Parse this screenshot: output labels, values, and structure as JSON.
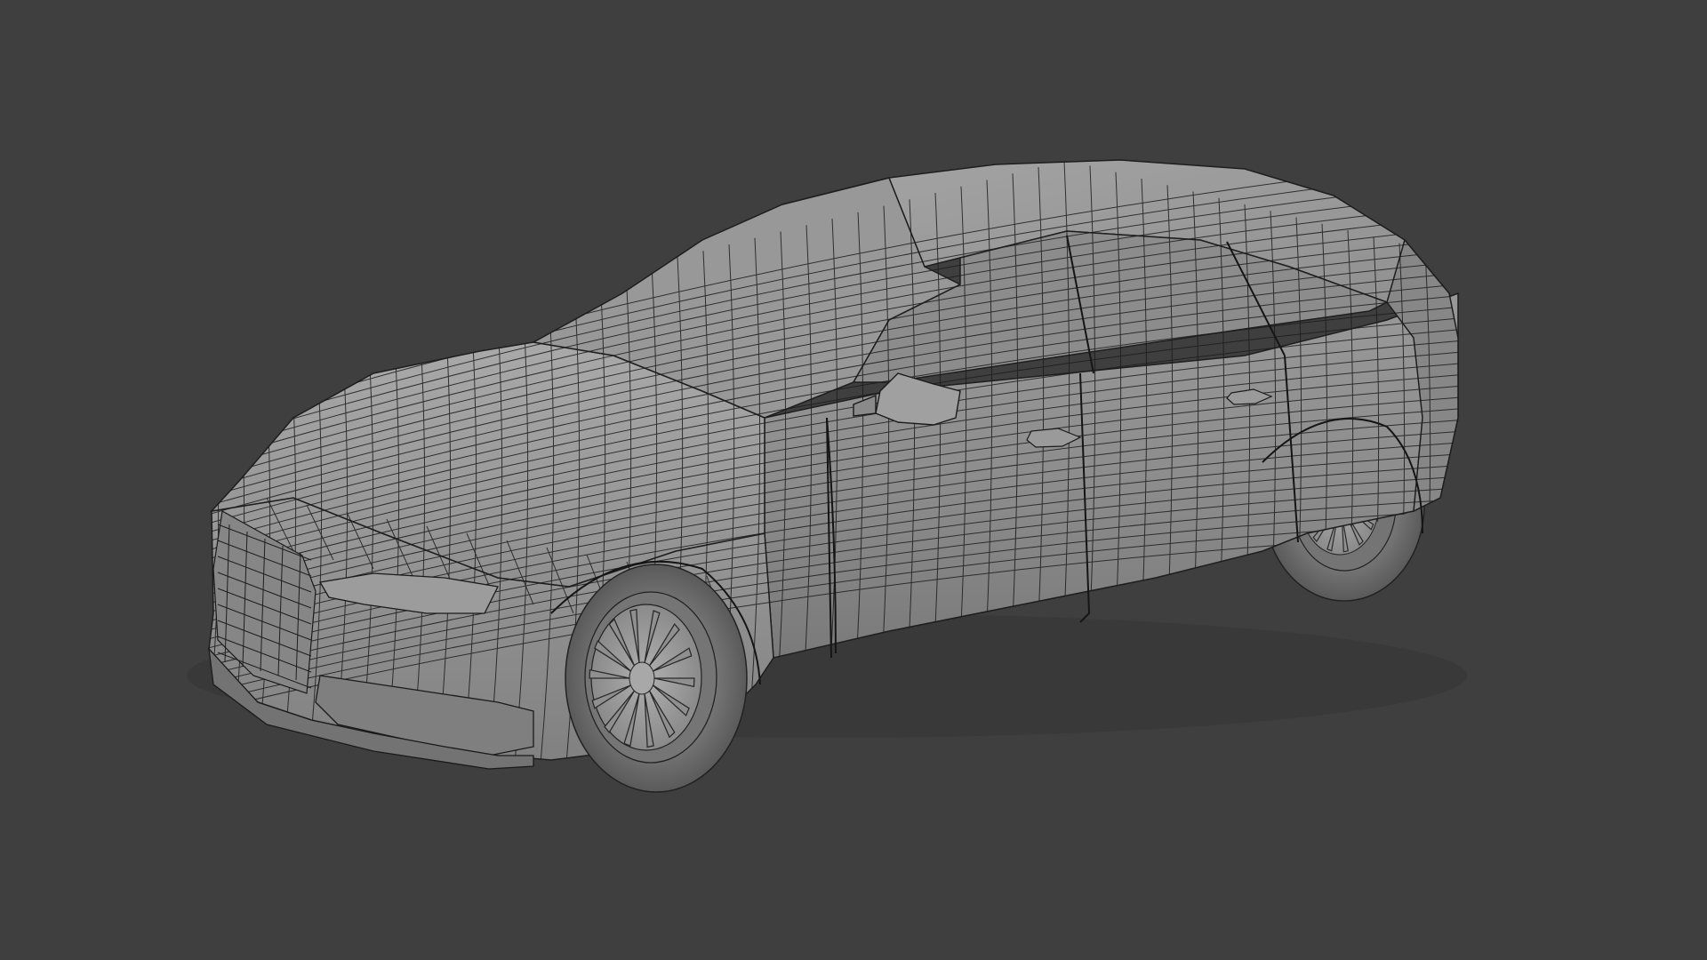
{
  "scene": {
    "background_color": "#3f3f3f",
    "model": "station-wagon-car",
    "view": "front-three-quarter-perspective",
    "shading": "solid-grey-with-wireframe-overlay",
    "colors": {
      "body_light": "#a3a3a3",
      "body_mid": "#8e8e8e",
      "body_dark": "#747474",
      "glass": "#8a8a8a",
      "tire": "#5e5e5e",
      "rim": "#9d9d9d",
      "wire": "#1e1e1e"
    }
  }
}
